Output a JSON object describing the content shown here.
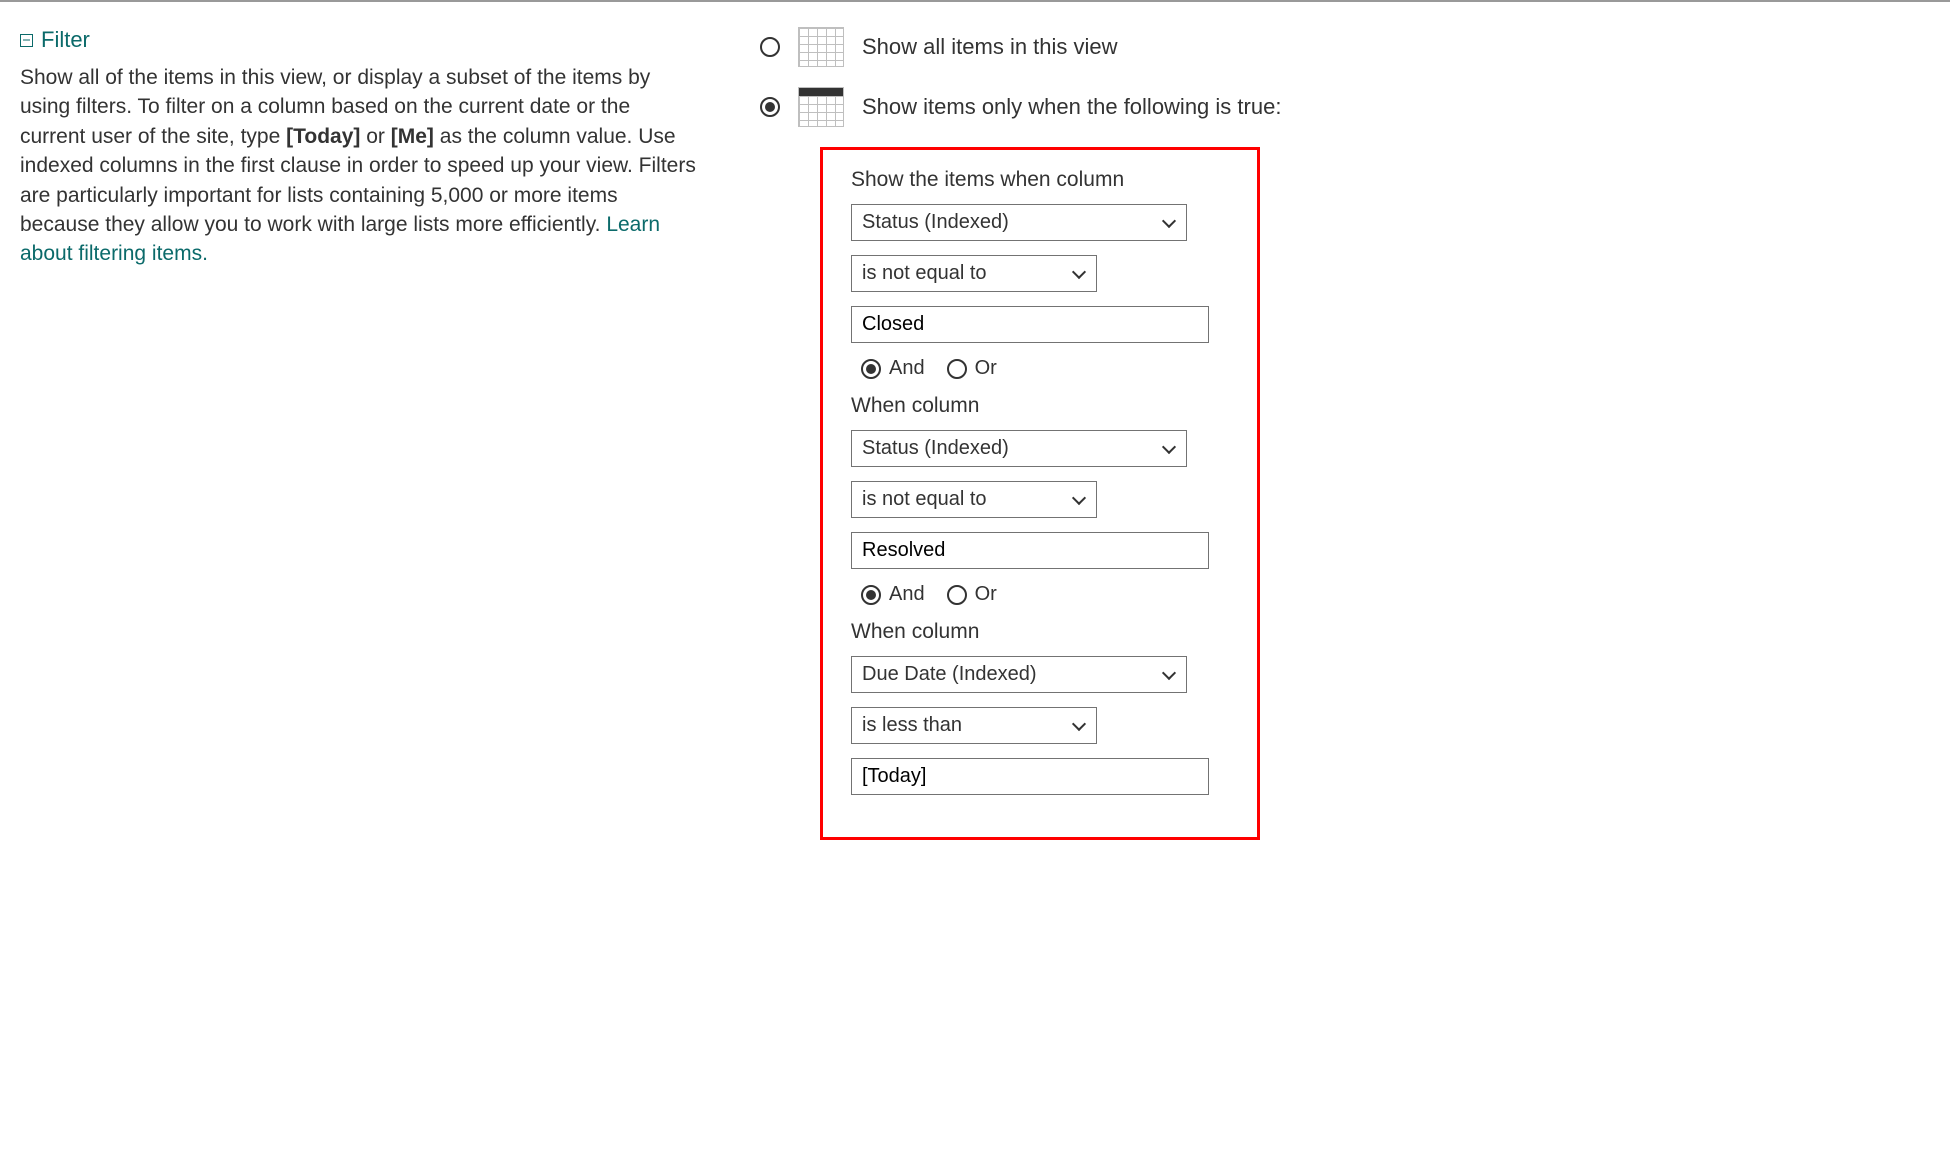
{
  "section": {
    "title": "Filter",
    "desc_parts": {
      "p1": "Show all of the items in this view, or display a subset of the items by using filters. To filter on a column based on the current date or the current user of the site, type ",
      "today": "[Today]",
      "or": " or ",
      "me": "[Me]",
      "p2": " as the column value. Use indexed columns in the first clause in order to speed up your view. Filters are particularly important for lists containing 5,000 or more items because they allow you to work with large lists more efficiently. ",
      "link": "Learn about filtering items."
    }
  },
  "options": {
    "show_all": "Show all items in this view",
    "show_filtered": "Show items only when the following is true:"
  },
  "filters": {
    "label_first": "Show the items when column",
    "label_next": "When column",
    "and": "And",
    "or": "Or",
    "items": [
      {
        "column": "Status (Indexed)",
        "operator": "is not equal to",
        "value": "Closed",
        "andor": "and"
      },
      {
        "column": "Status (Indexed)",
        "operator": "is not equal to",
        "value": "Resolved",
        "andor": "and"
      },
      {
        "column": "Due Date (Indexed)",
        "operator": "is less than",
        "value": "[Today]"
      }
    ]
  }
}
